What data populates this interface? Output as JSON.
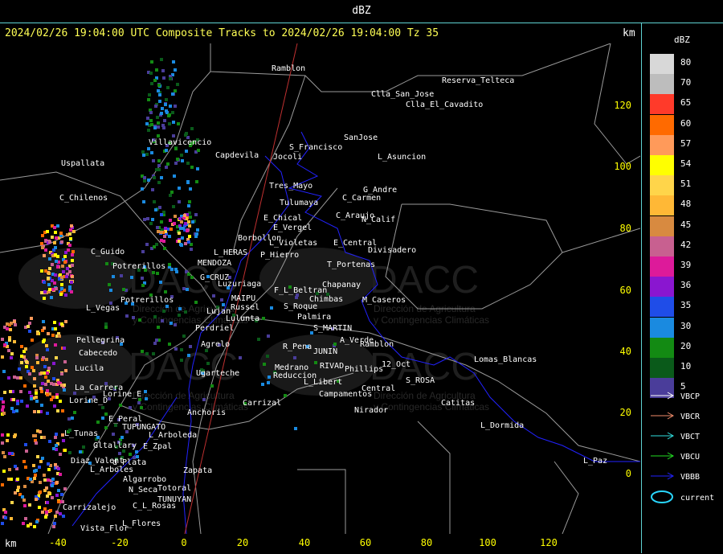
{
  "top_title": "dBZ",
  "header": "2024/02/26 19:04:00 UTC Composite Tracks to 2024/02/26 19:04:00 Tz 35",
  "units_right": "km",
  "units_bottom": "km",
  "y_ticks": [
    "120",
    "100",
    "80",
    "60",
    "40",
    "20",
    "0"
  ],
  "x_ticks": [
    "-40",
    "-20",
    "0",
    "20",
    "40",
    "60",
    "80",
    "100",
    "120"
  ],
  "watermark": {
    "logo": "DACC",
    "line1": "Dirección de Agricultura",
    "line2": "y Contingencias Climáticas"
  },
  "legend": {
    "title": "dBZ",
    "levels": [
      {
        "label": "80",
        "color": "#d8d8d8"
      },
      {
        "label": "70",
        "color": "#bdbdbd"
      },
      {
        "label": "65",
        "color": "#ff3a2a"
      },
      {
        "label": "60",
        "color": "#ff6a00"
      },
      {
        "label": "57",
        "color": "#ff9a5a"
      },
      {
        "label": "54",
        "color": "#ffff00"
      },
      {
        "label": "51",
        "color": "#ffd54a"
      },
      {
        "label": "48",
        "color": "#ffb836"
      },
      {
        "label": "45",
        "color": "#d88a40"
      },
      {
        "label": "42",
        "color": "#c86090"
      },
      {
        "label": "39",
        "color": "#dd1a9a"
      },
      {
        "label": "36",
        "color": "#8a16d0"
      },
      {
        "label": "35",
        "color": "#1f4de8"
      },
      {
        "label": "30",
        "color": "#1a8ae0"
      },
      {
        "label": "20",
        "color": "#138a13"
      },
      {
        "label": "10",
        "color": "#0a5a1a"
      },
      {
        "label": "5",
        "color": "#4a3d9a"
      }
    ],
    "tracks": [
      {
        "label": "VBCP",
        "color": "#ffffff"
      },
      {
        "label": "VBCR",
        "color": "#f08c6a"
      },
      {
        "label": "VBCT",
        "color": "#30e0e0"
      },
      {
        "label": "VBCU",
        "color": "#22dd22"
      },
      {
        "label": "VBBB",
        "color": "#2222ff"
      }
    ],
    "current_label": "current",
    "current_color": "#29d7ff"
  },
  "towns": [
    "Ramblon",
    "Reserva_Telteca",
    "Clla_San_Jose",
    "Clla_El_Cavadito",
    "S_Francisco",
    "Jocoli",
    "SanJose",
    "L_Asuncion",
    "Uspallata",
    "Villavicencio",
    "Capdevila",
    "C_Chilenos",
    "Tres_Mayo",
    "C_Carmen",
    "G_Andre",
    "Tulumaya",
    "E_Chical",
    "C_Araujo",
    "N_Calif",
    "E_Vergel",
    "Borbollon",
    "L_Violetas",
    "E_Central",
    "Divisadero",
    "C_Guido",
    "L_HERAS",
    "P_Hierro",
    "Potrerillos",
    "L_Vegas",
    "G_CRUZ",
    "Luzuriaga",
    "Chapanay",
    "T_Portenas",
    "F_L_Beltran",
    "Chimbas",
    "M_Caseros",
    "MAIPU",
    "Russel",
    "Lulunta",
    "S_Roque",
    "Palmira",
    "S_MARTIN",
    "Pellegrina",
    "Cabecedo",
    "Agrelo",
    "R_Pena",
    "JUNIN",
    "A_Verde",
    "Ramblon",
    "Lucila",
    "Medrano",
    "RIVAD",
    "Phillips",
    "12_Oct",
    "Lomas_Blancas",
    "Ugarteche",
    "Reduccion",
    "L_Libert",
    "S_ROSA",
    "La_Carrera",
    "Lorine_D",
    "Lorine_E",
    "Campamentos",
    "Central",
    "Catitas",
    "E_Peral",
    "TUPUNGATO",
    "Anchoris",
    "Carrizal",
    "Nirador",
    "L_Dormida",
    "L_Tunas",
    "L_Arboleda",
    "Gltallary",
    "E_Zpal",
    "Diaz_Valent",
    "L_Arboles",
    "Algarrobo",
    "Zapata",
    "L_Paz",
    "Carrizalejo",
    "C_L_Rosas",
    "TUNUYAN",
    "Vista_Flor",
    "L_Flores",
    "MENDOZA",
    "Potrerillos",
    "Perdriel",
    "Lujan",
    "d_Plata",
    "N_Seca",
    "Totoral"
  ]
}
